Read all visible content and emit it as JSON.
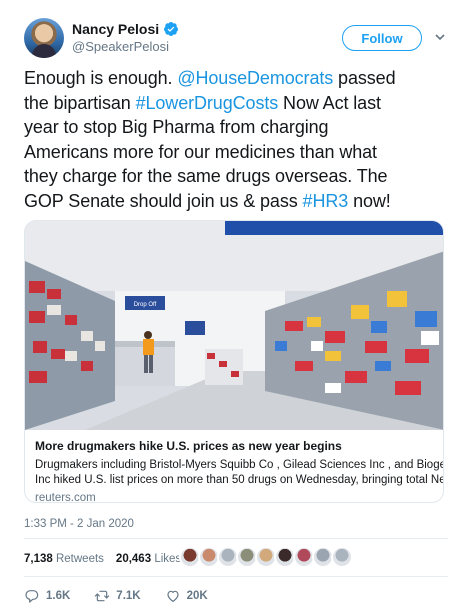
{
  "user": {
    "display_name": "Nancy Pelosi",
    "handle": "@SpeakerPelosi",
    "follow_label": "Follow"
  },
  "tweet": {
    "lines": [
      [
        {
          "t": "Enough is enough. "
        },
        {
          "t": "@HouseDemocrats",
          "link": true
        },
        {
          "t": " passed"
        }
      ],
      [
        {
          "t": "the bipartisan "
        },
        {
          "t": "#LowerDrugCosts",
          "link": true
        },
        {
          "t": " Now Act last"
        }
      ],
      [
        {
          "t": "year to stop Big Pharma from charging"
        }
      ],
      [
        {
          "t": "Americans more for our medicines than what"
        }
      ],
      [
        {
          "t": "they charge for the same drugs overseas. The"
        }
      ],
      [
        {
          "t": "GOP Senate should join us & pass "
        },
        {
          "t": "#HR3",
          "link": true
        },
        {
          "t": " now!"
        }
      ]
    ]
  },
  "card": {
    "image_sign": "Drop Off",
    "title": "More drugmakers hike U.S. prices as new year begins",
    "description_lines": [
      "Drugmakers including Bristol-Myers Squibb Co , Gilead Sciences Inc , and Biogen",
      "Inc hiked U.S. list prices on more than 50 drugs on Wednesday, bringing total New"
    ],
    "domain": "reuters.com"
  },
  "timestamp": "1:33 PM - 2 Jan 2020",
  "stats": {
    "retweets_count": "7,138",
    "retweets_label": "Retweets",
    "likes_count": "20,463",
    "likes_label": "Likes"
  },
  "likers": [
    "#7a3b2e",
    "#c98a6d",
    "#a9b4bf",
    "#8b8f7a",
    "#d1a97a",
    "#3a2a2a",
    "#b04a5a",
    "#9aa5b1",
    "#aab4be"
  ],
  "actions": {
    "reply_count": "1.6K",
    "retweet_count": "7.1K",
    "like_count": "20K"
  },
  "colors": {
    "accent": "#1da1f2",
    "link": "#1b95e0",
    "muted": "#657786"
  }
}
